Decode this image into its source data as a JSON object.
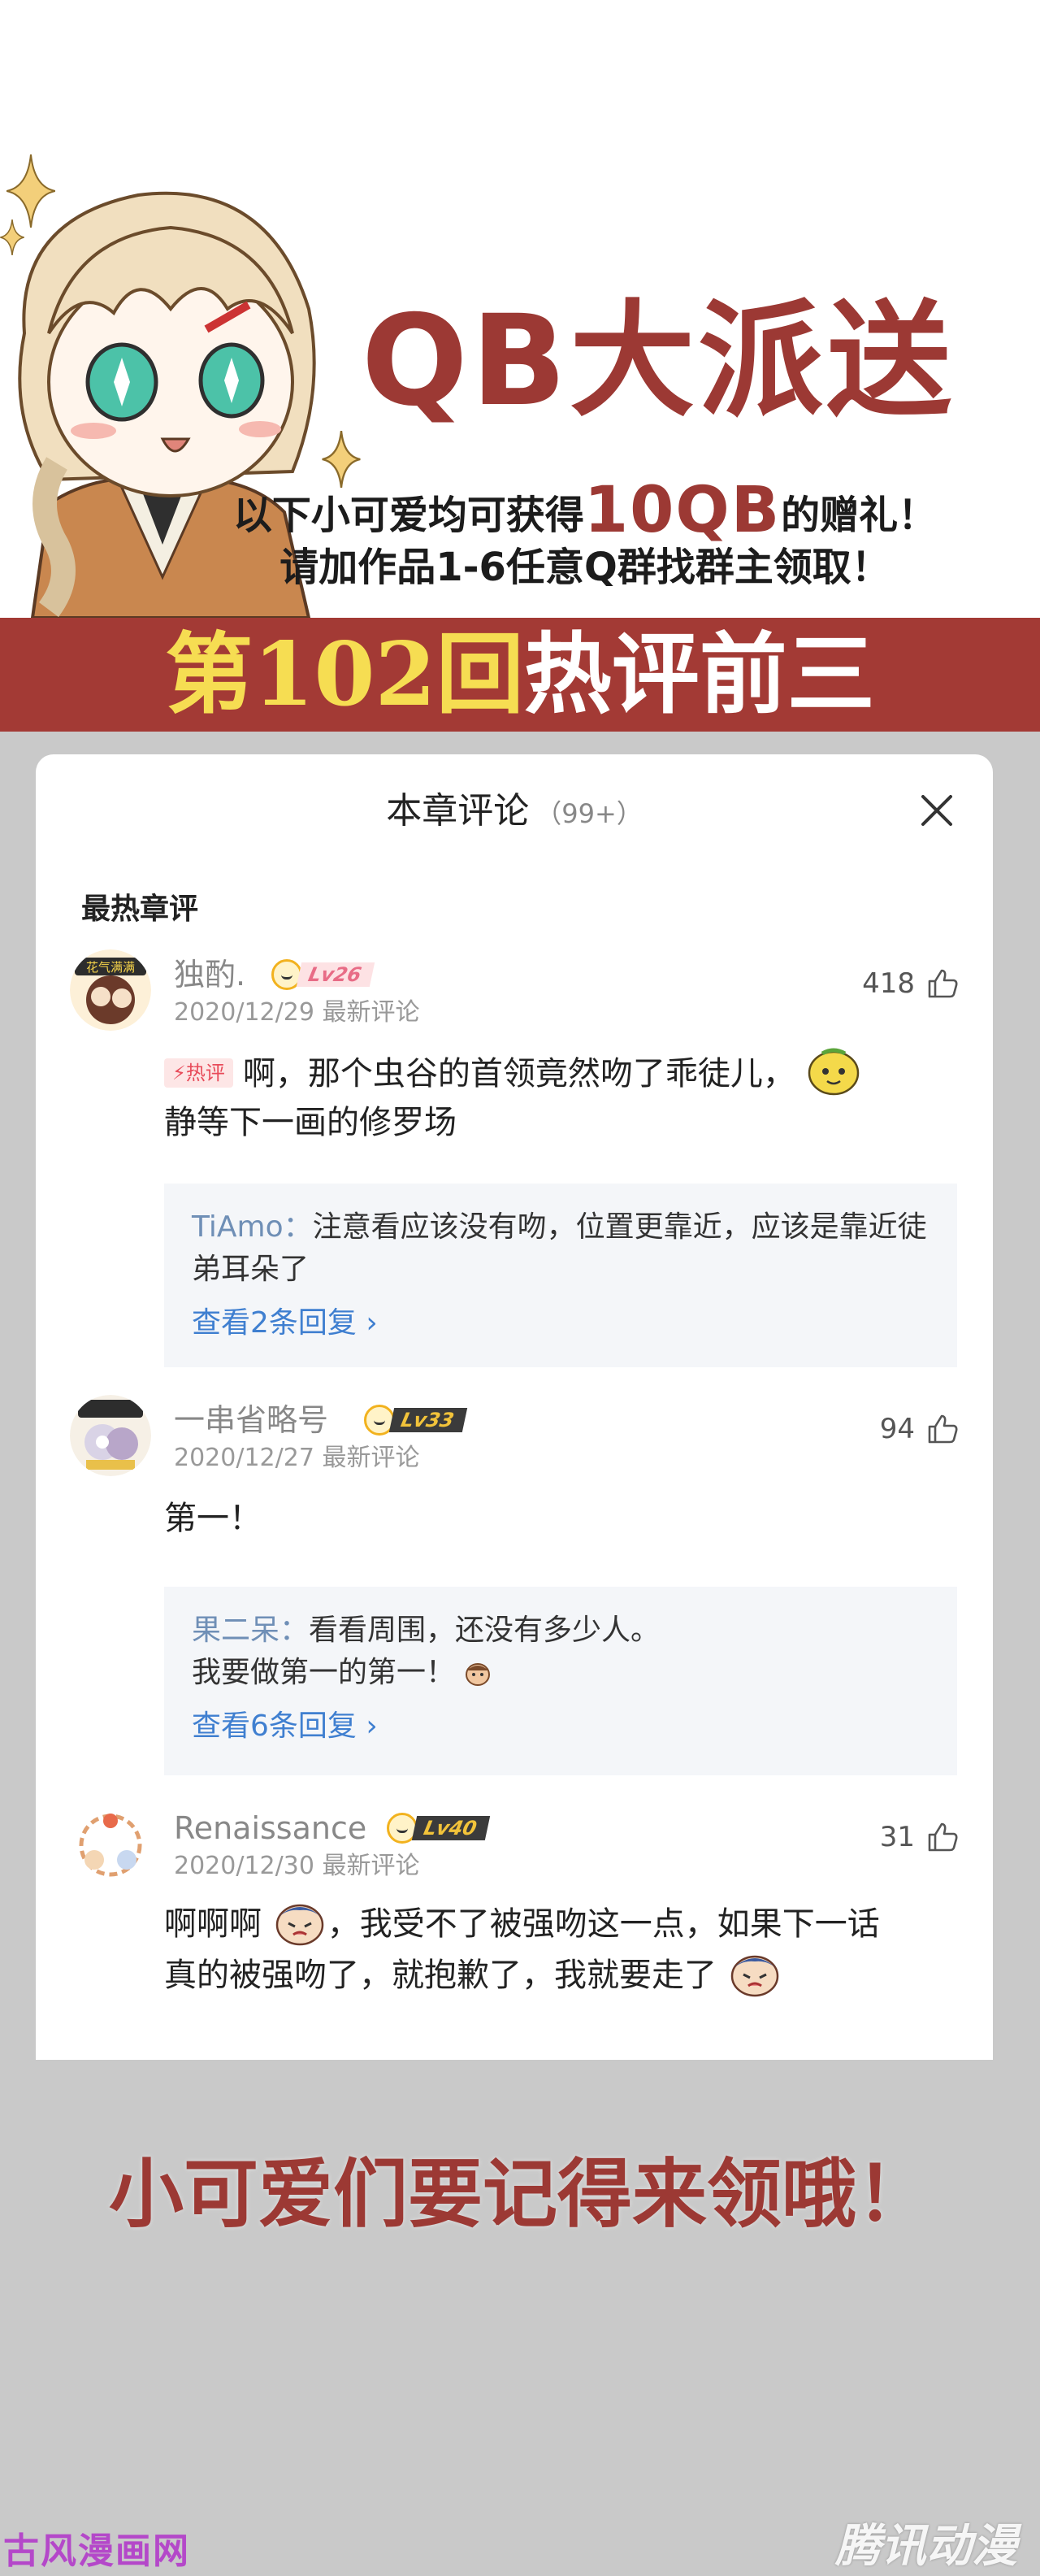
{
  "banner": {
    "headline": "QB大派送",
    "subline1_pre": "以下小可爱均可获得",
    "subline1_amount": "10QB",
    "subline1_post": "的赠礼！",
    "subline2": "请加作品1-6任意Q群找群主领取！",
    "ranking_part1": "第102回",
    "ranking_part2": "热评前三"
  },
  "panel": {
    "title": "本章评论",
    "count": "（99+）",
    "close_icon": "close-icon",
    "section_label": "最热章评"
  },
  "comments": [
    {
      "username": "独酌.",
      "level": "Lv26",
      "date": "2020/12/29 最新评论",
      "likes": "418",
      "hot_badge": "热评",
      "text_a": "啊，那个虫谷的首领竟然吻了乖徒儿，",
      "text_b": "静等下一画的修罗场",
      "reply_name": "TiAmo：",
      "reply_text": "注意看应该没有吻，位置更靠近，应该是靠近徒弟耳朵了",
      "more": "查看2条回复",
      "avatar_badge": "花气满满"
    },
    {
      "username": "一串省略号",
      "level": "Lv33",
      "date": "2020/12/27 最新评论",
      "likes": "94",
      "text_a": "第一！",
      "reply_name": "果二呆：",
      "reply_text": "看看周围，还没有多少人。",
      "reply_text2": "我要做第一的第一！",
      "more": "查看6条回复"
    },
    {
      "username": "Renaissance",
      "level": "Lv40",
      "date": "2020/12/30 最新评论",
      "likes": "31",
      "text_a": "啊啊啊",
      "text_b": "，我受不了被强吻这一点，如果下一话",
      "text_c": "真的被强吻了，就抱歉了，我就要走了"
    }
  ],
  "footer": {
    "reminder": "小可爱们要记得来领哦！",
    "watermark_left": "古风漫画网",
    "watermark_right": "腾讯动漫"
  },
  "colors": {
    "brand_red": "#9c3934",
    "bar_red": "#a33a35",
    "highlight_yellow": "#f6dd52",
    "link_blue": "#3f7fd0",
    "background_gray": "#c9c9c9"
  }
}
